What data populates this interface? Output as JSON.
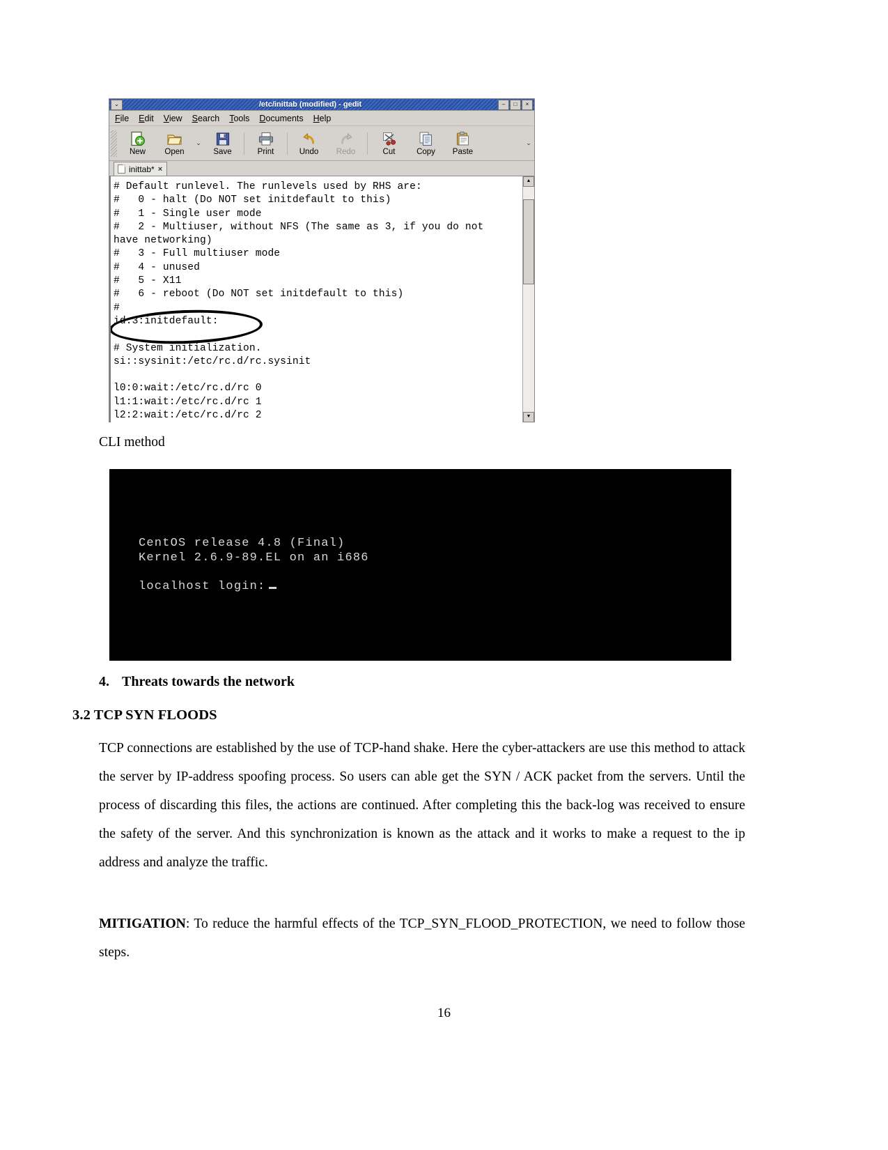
{
  "gedit": {
    "window_title": "/etc/inittab (modified) - gedit",
    "window_menu_icon": "window-menu-icon",
    "controls": {
      "minimize": "–",
      "maximize": "□",
      "close": "×"
    },
    "menubar": [
      {
        "label": "File",
        "mnemonic": "F"
      },
      {
        "label": "Edit",
        "mnemonic": "E"
      },
      {
        "label": "View",
        "mnemonic": "V"
      },
      {
        "label": "Search",
        "mnemonic": "S"
      },
      {
        "label": "Tools",
        "mnemonic": "T"
      },
      {
        "label": "Documents",
        "mnemonic": "D"
      },
      {
        "label": "Help",
        "mnemonic": "H"
      }
    ],
    "toolbar": [
      {
        "label": "New",
        "icon": "new-document-icon",
        "enabled": true
      },
      {
        "label": "Open",
        "icon": "open-folder-icon",
        "enabled": true
      },
      {
        "label": "Save",
        "icon": "save-floppy-icon",
        "enabled": true
      },
      {
        "label": "Print",
        "icon": "printer-icon",
        "enabled": true
      },
      {
        "label": "Undo",
        "icon": "undo-arrow-icon",
        "enabled": true
      },
      {
        "label": "Redo",
        "icon": "redo-arrow-icon",
        "enabled": false
      },
      {
        "label": "Cut",
        "icon": "scissors-icon",
        "enabled": true
      },
      {
        "label": "Copy",
        "icon": "copy-pages-icon",
        "enabled": true
      },
      {
        "label": "Paste",
        "icon": "clipboard-paste-icon",
        "enabled": true
      }
    ],
    "toolbar_overflow_icon": "chevron-down-icon",
    "open_dropdown_icon": "chevron-down-icon",
    "tab": {
      "label": "inittab*",
      "close_label": "×",
      "icon": "text-file-icon"
    },
    "scrollbar": {
      "up_arrow": "▲",
      "down_arrow": "▼"
    },
    "code_lines": [
      "# Default runlevel. The runlevels used by RHS are:",
      "#   0 - halt (Do NOT set initdefault to this)",
      "#   1 - Single user mode",
      "#   2 - Multiuser, without NFS (The same as 3, if you do not",
      "have networking)",
      "#   3 - Full multiuser mode",
      "#   4 - unused",
      "#   5 - X11",
      "#   6 - reboot (Do NOT set initdefault to this)",
      "#",
      "id:3:initdefault:",
      "",
      "# System initialization.",
      "si::sysinit:/etc/rc.d/rc.sysinit",
      "",
      "l0:0:wait:/etc/rc.d/rc 0",
      "l1:1:wait:/etc/rc.d/rc 1",
      "l2:2:wait:/etc/rc.d/rc 2"
    ],
    "annotation": "hand-drawn-ellipse-around-initdefault"
  },
  "caption": {
    "cli_method": "CLI method"
  },
  "terminal": {
    "line1": "CentOS release 4.8 (Final)",
    "line2": "Kernel 2.6.9-89.EL on an i686",
    "line3": "localhost login:",
    "cursor": "block-cursor"
  },
  "document": {
    "numbered_heading": {
      "number": "4.",
      "text": "Threats towards the network"
    },
    "section_heading": "3.2 TCP SYN FLOODS",
    "paragraph1": "TCP connections are established by the use of TCP-hand shake. Here the cyber-attackers are use this method to attack the server by IP-address spoofing process. So users can able get the SYN / ACK packet from the servers. Until the process of discarding this files, the actions are continued. After completing this the back-log was received to ensure the safety of the server. And this synchronization is known as the attack and it works to make a request to the ip address and analyze the traffic.",
    "mitigation_label": "MITIGATION",
    "mitigation_text": ": To reduce the harmful effects of the TCP_SYN_FLOOD_PROTECTION, we need to follow those steps.",
    "page_number": "16"
  },
  "colors": {
    "titlebar_blue": "#2a4f9e",
    "chrome_gray": "#d6d3ce",
    "terminal_bg": "#000000",
    "terminal_fg": "#d8d8d8",
    "text_black": "#000000"
  }
}
